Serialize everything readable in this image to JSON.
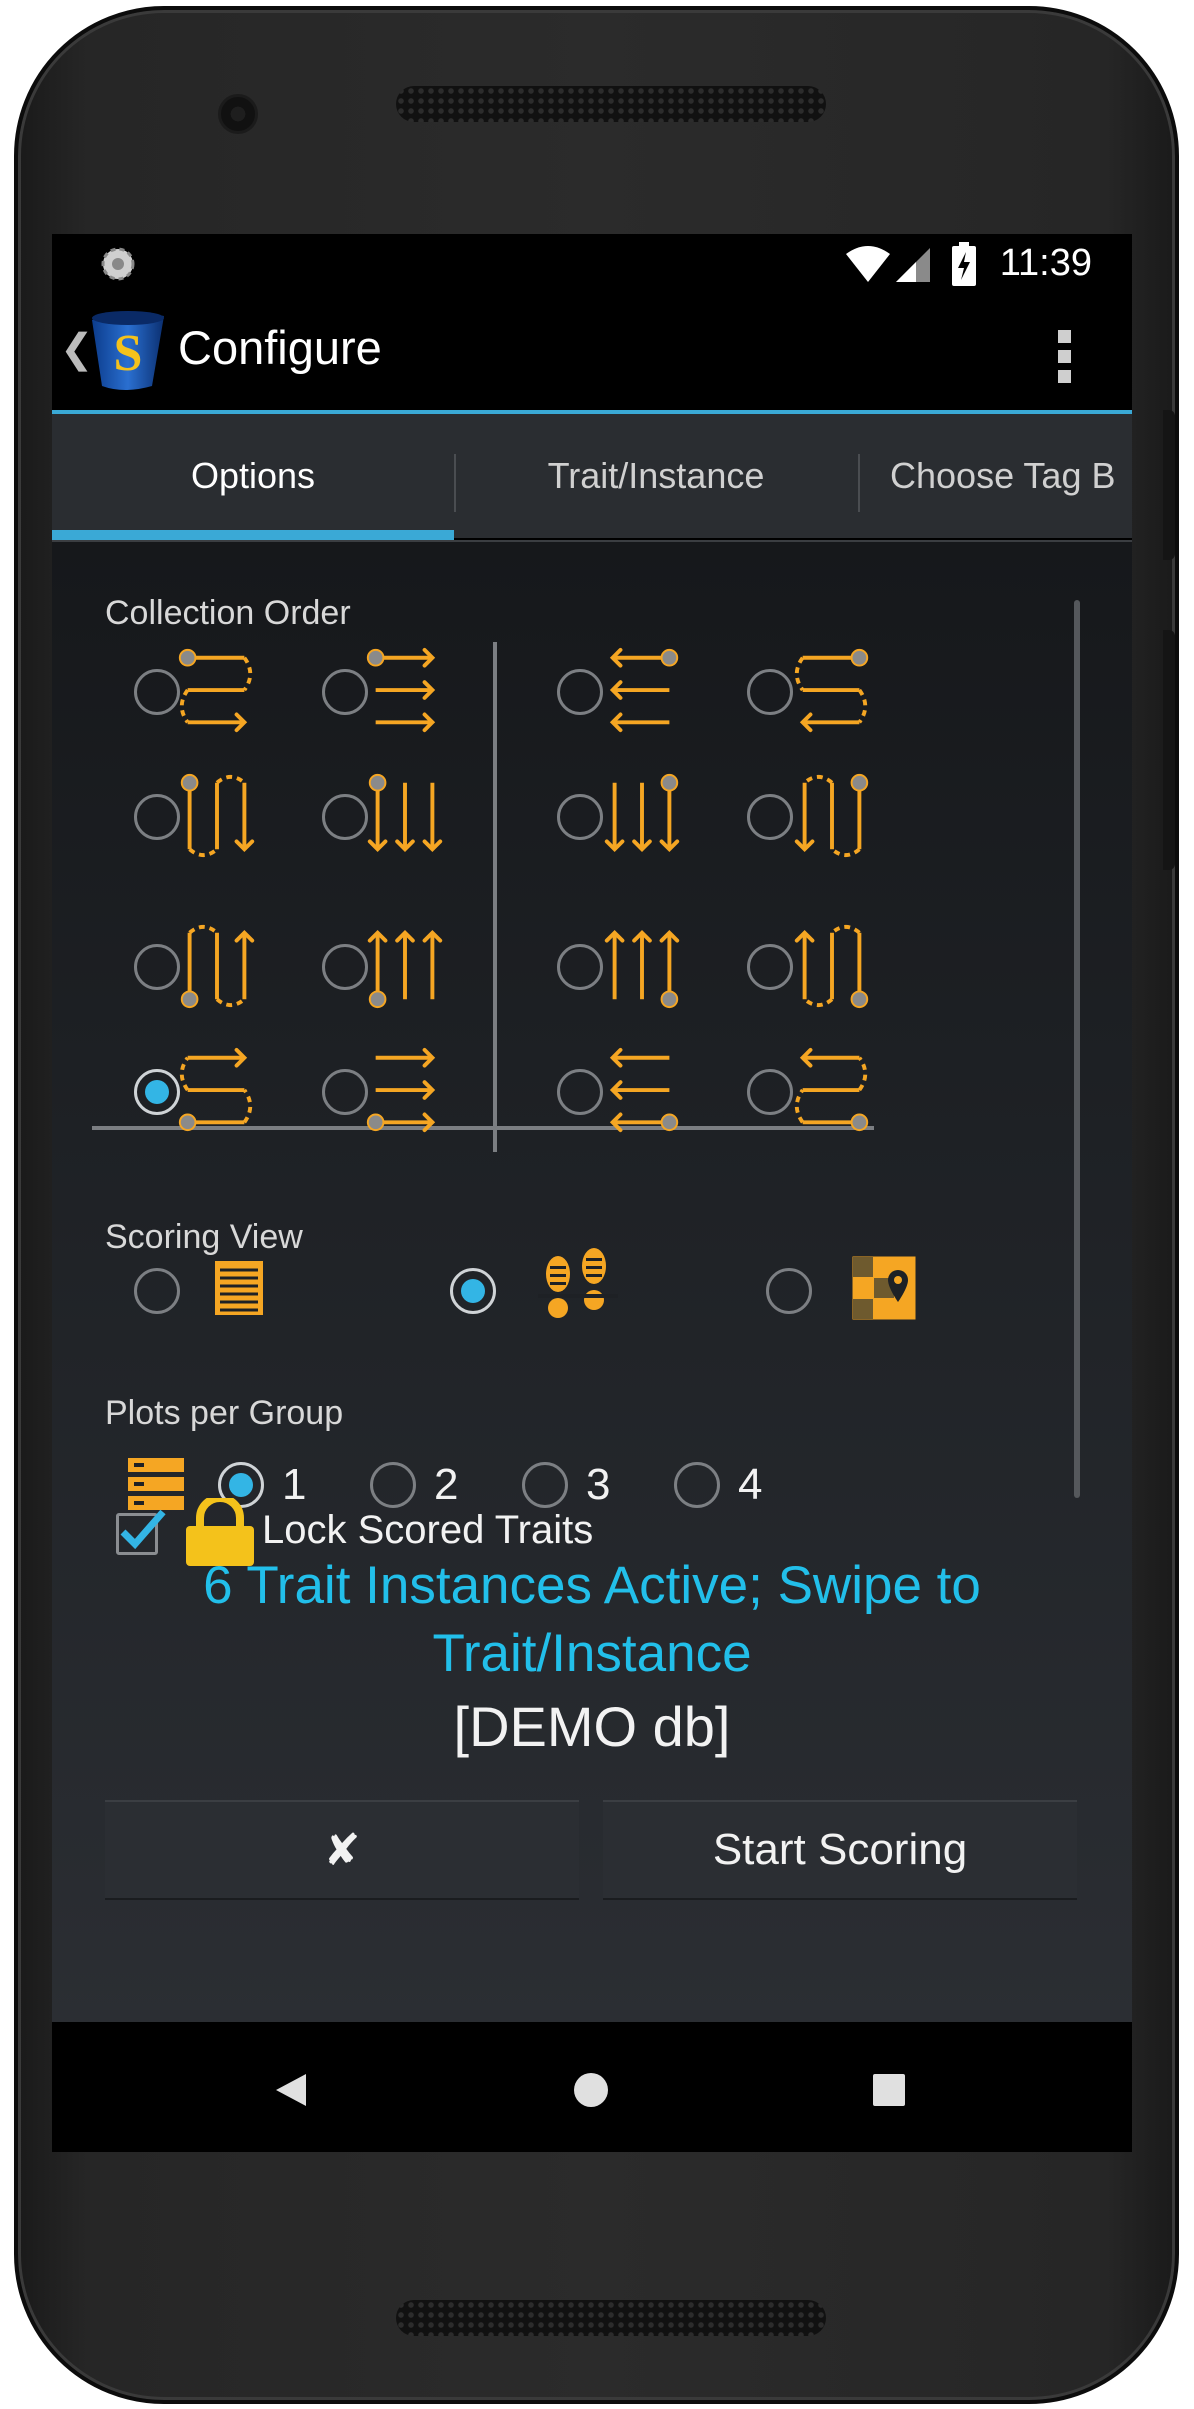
{
  "status_bar": {
    "time": "11:39"
  },
  "action_bar": {
    "title": "Configure"
  },
  "tabs": [
    {
      "label": "Options",
      "active": true
    },
    {
      "label": "Trait/Instance",
      "active": false
    },
    {
      "label": "Choose Tag B",
      "active": false
    }
  ],
  "options": {
    "collection_order": {
      "label": "Collection Order",
      "selected_index": 12
    },
    "scoring_view": {
      "label": "Scoring View",
      "options": [
        {
          "icon": "list-icon",
          "selected": false
        },
        {
          "icon": "footprints-icon",
          "selected": true
        },
        {
          "icon": "map-pin-icon",
          "selected": false
        }
      ]
    },
    "plots_per_group": {
      "label": "Plots per Group",
      "icon": "stacked-rows-icon",
      "options": [
        {
          "label": "1",
          "selected": true
        },
        {
          "label": "2",
          "selected": false
        },
        {
          "label": "3",
          "selected": false
        },
        {
          "label": "4",
          "selected": false
        }
      ]
    },
    "lock_scored_traits": {
      "label": "Lock Scored Traits",
      "checked": true
    },
    "active_summary": "6 Trait Instances Active; Swipe to Trait/Instance",
    "database_label": "[DEMO db]"
  },
  "buttons": {
    "cancel_label": "✘",
    "start_label": "Start Scoring"
  },
  "colors": {
    "accent": "#33b5e5",
    "icon_orange": "#f5a623",
    "highlight_text": "#22bfea"
  }
}
